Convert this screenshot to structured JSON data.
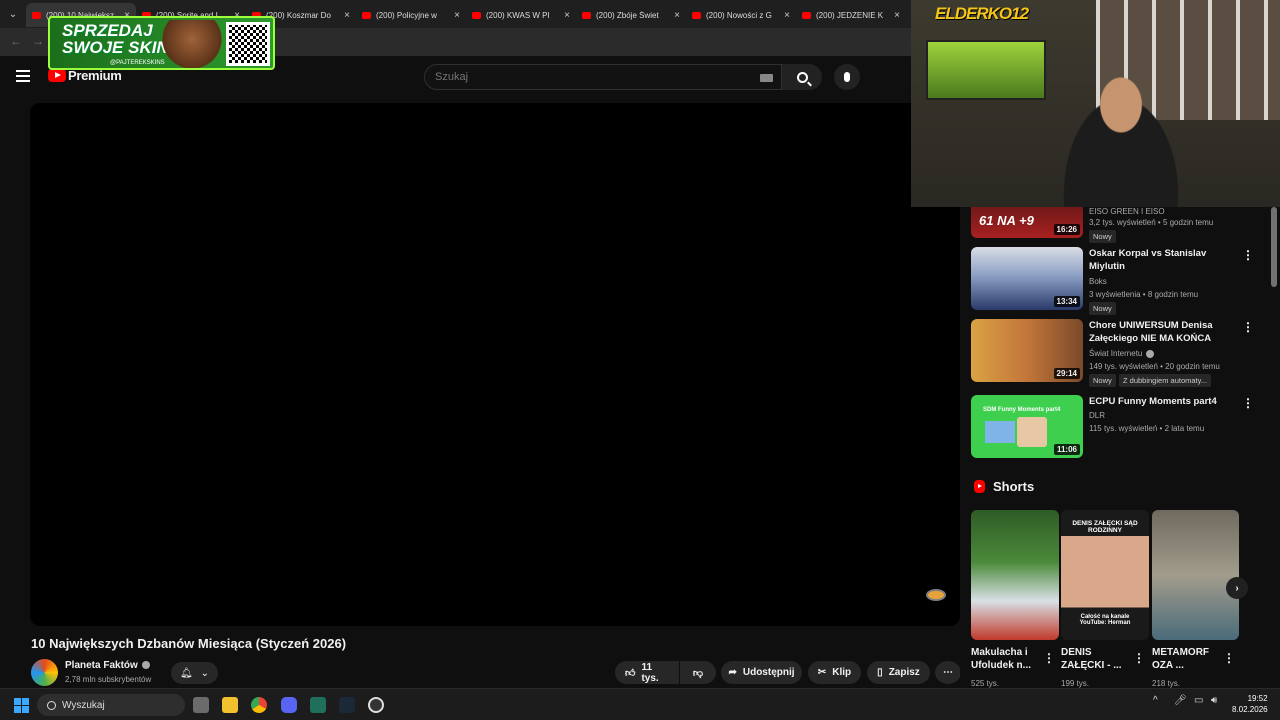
{
  "browser": {
    "tabs": [
      {
        "title": "(200) 10 Największ"
      },
      {
        "title": "(200) Sprite and I"
      },
      {
        "title": "(200) Koszmar Do"
      },
      {
        "title": "(200) Policyjne w"
      },
      {
        "title": "(200) KWAS W PI"
      },
      {
        "title": "(200) Zbóje Świet"
      },
      {
        "title": "(200) Nowości z G"
      },
      {
        "title": "(200) JEDZENIE K"
      }
    ]
  },
  "overlay_ad": {
    "text_line1": "SPRZEDAJ",
    "text_line2": "SWOJE SKINY",
    "handle": "@PAJTEREKSKINS"
  },
  "youtube": {
    "logo_text": "Premium",
    "search": {
      "placeholder": "Szukaj"
    },
    "video": {
      "title": "10 Największych Dzbanów Miesiąca (Styczeń 2026)",
      "channel": "Planeta Faktów",
      "subscribers": "2,78 mln subskrybentów",
      "likes": "11 tys.",
      "share_label": "Udostępnij",
      "clip_label": "Klip",
      "save_label": "Zapisz"
    },
    "recommendations": [
      {
        "title": "EISO GREEN I EISO",
        "channel": "",
        "meta": "3,2 tys. wyświetleń • 5 godzin temu",
        "duration": "16:26",
        "badge": "Nowy",
        "thumb_text": "61 NA +9"
      },
      {
        "title": "Oskar Korpal vs Stanislav Miylutin",
        "channel": "Boks",
        "meta": "3 wyświetlenia • 8 godzin temu",
        "duration": "13:34",
        "badge": "Nowy"
      },
      {
        "title": "Chore UNIWERSUM Denisa Załęckiego NIE MA KOŃCA",
        "channel": "Świat Internetu",
        "meta": "149 tys. wyświetleń • 20 godzin temu",
        "duration": "29:14",
        "badge": "Nowy",
        "dub": "Z dubbingiem automaty..."
      },
      {
        "title": "ECPU Funny Moments part4",
        "channel": "DLR",
        "meta": "115 tys. wyświetleń • 2 lata temu",
        "duration": "11:06",
        "thumb_text": "SDM Funny Moments part4"
      }
    ],
    "shorts": {
      "heading": "Shorts",
      "items": [
        {
          "title": "Makulacha i Ufoludek n...",
          "views": "525 tys."
        },
        {
          "title": "DENIS ZAŁĘCKI - ...",
          "views": "199 tys.",
          "thumb_top": "DENIS ZAŁĘCKI SĄD RODZINNY",
          "thumb_bottom": "Całość na kanale YouTube: Herman"
        },
        {
          "title": "METAMORF OZA ...",
          "views": "218 tys."
        }
      ]
    }
  },
  "webcam": {
    "logo": "ELDERKO12"
  },
  "taskbar": {
    "search_label": "Wyszukaj",
    "time": "19:52",
    "date": "8.02.2026"
  },
  "colors": {
    "accent": "#ff0000",
    "bg": "#0f0f0f",
    "pill": "#272727"
  }
}
